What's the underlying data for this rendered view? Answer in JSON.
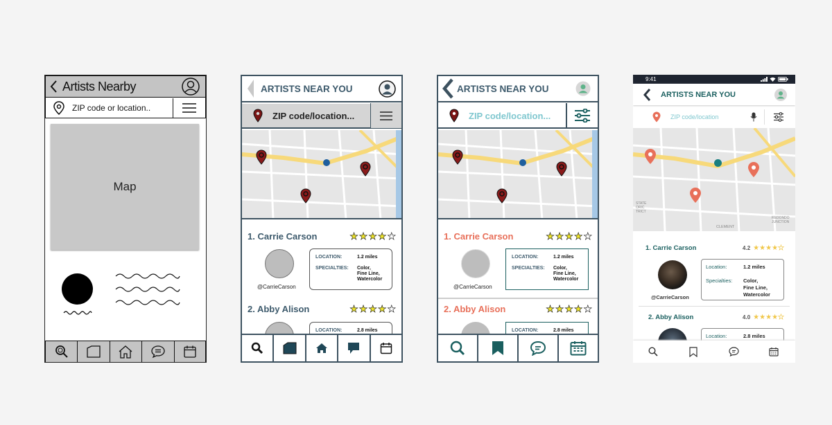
{
  "wireframe": {
    "title": "Artists Nearby",
    "search_placeholder": "ZIP code or location..",
    "map_label": "Map"
  },
  "mid_v1": {
    "title": "ARTISTS NEAR YOU",
    "search_placeholder": "ZIP code/location...",
    "artists": [
      {
        "name": "1. Carrie Carson",
        "handle": "@CarrieCarson",
        "location_label": "LOCATION:",
        "location": "1.2 miles",
        "specialties_label": "SPECIALTIES:",
        "specialties": [
          "Color,",
          "Fine Line,",
          "Watercolor"
        ]
      },
      {
        "name": "2. Abby Alison",
        "location_label": "LOCATION:",
        "location": "2.8 miles"
      }
    ]
  },
  "mid_v2": {
    "title": "ARTISTS NEAR YOU",
    "search_placeholder": "ZIP code/location...",
    "artists": [
      {
        "name": "1. Carrie Carson",
        "handle": "@CarrieCarson",
        "location_label": "LOCATION:",
        "location": "1.2 miles",
        "specialties_label": "SPECIALTIES:",
        "specialties": [
          "Color,",
          "Fine Line,",
          "Watercolor"
        ]
      },
      {
        "name": "2. Abby Alison",
        "location_label": "LOCATION:",
        "location": "2.8 miles"
      }
    ]
  },
  "hifi": {
    "status_time": "9:41",
    "title": "ARTISTS NEAR YOU",
    "search_placeholder": "ZIP code/location",
    "map_labels": {
      "historic": "STATE\nORIC\nTRICT",
      "clement": "CLEMENT",
      "redondo": "REDONDO\nJUNCTION"
    },
    "artists": [
      {
        "name": "1. Carrie Carson",
        "rating": "4.2",
        "handle": "@CarrieCarson",
        "location_label": "Location:",
        "location": "1.2 miles",
        "specialties_label": "Specialties:",
        "specialties": [
          "Color,",
          "Fine Line,",
          "Watercolor"
        ]
      },
      {
        "name": "2. Abby Alison",
        "rating": "4.0",
        "location_label": "Location:",
        "location": "2.8 miles"
      }
    ]
  },
  "colors": {
    "teal": "#1a5f5f",
    "slate": "#3d5a6c",
    "coral": "#e8705a",
    "marker": "#8a1a1a",
    "star": "#f0e62a",
    "map_road": "#f7d97a",
    "map_bg": "#e6e6e6"
  }
}
